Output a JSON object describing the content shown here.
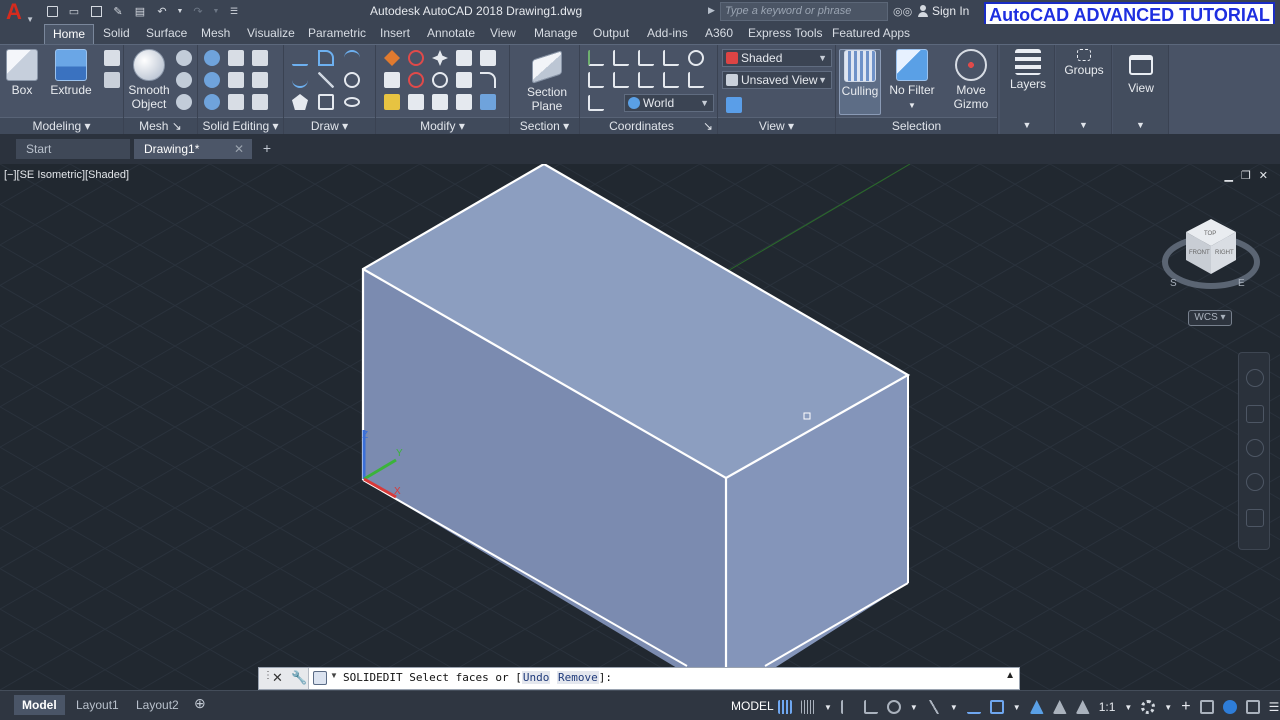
{
  "app": {
    "logo": "A",
    "window_title": "Autodesk AutoCAD 2018   Drawing1.dwg",
    "search_placeholder": "Type a keyword or phrase",
    "sign_in": "Sign In",
    "banner": "AutoCAD ADVANCED TUTORIAL"
  },
  "ribbon_tabs": [
    "Home",
    "Solid",
    "Surface",
    "Mesh",
    "Visualize",
    "Parametric",
    "Insert",
    "Annotate",
    "View",
    "Manage",
    "Output",
    "Add-ins",
    "A360",
    "Express Tools",
    "Featured Apps"
  ],
  "panels": {
    "modeling": {
      "title": "Modeling",
      "box": "Box",
      "extrude": "Extrude"
    },
    "mesh": {
      "title": "Mesh",
      "smooth_1": "Smooth",
      "smooth_2": "Object"
    },
    "solid_editing": {
      "title": "Solid Editing"
    },
    "draw": {
      "title": "Draw"
    },
    "modify": {
      "title": "Modify"
    },
    "section": {
      "title": "Section",
      "plane_1": "Section",
      "plane_2": "Plane"
    },
    "coordinates": {
      "title": "Coordinates",
      "ucs_value": "World"
    },
    "view": {
      "title": "View",
      "visual_style": "Shaded",
      "named_view": "Unsaved View"
    },
    "selection": {
      "title": "Selection",
      "culling": "Culling",
      "no_filter": "No Filter",
      "gizmo_1": "Move",
      "gizmo_2": "Gizmo"
    },
    "layers": {
      "label": "Layers"
    },
    "groups": {
      "label": "Groups"
    },
    "view_btn": {
      "label": "View"
    }
  },
  "doc_tabs": {
    "start": "Start",
    "drawing": "Drawing1*"
  },
  "viewport": {
    "label": "[−][SE Isometric][Shaded]",
    "wcs": "WCS",
    "viewcube_faces": [
      "TOP",
      "FRONT",
      "RIGHT"
    ],
    "compass": [
      "S",
      "E"
    ]
  },
  "command": {
    "name": "SOLIDEDIT",
    "prompt": "Select faces or",
    "options_open": "[",
    "opt_undo": "Undo",
    "opt_remove": "Remove",
    "options_close": "]:"
  },
  "status": {
    "layout_tabs": [
      "Model",
      "Layout1",
      "Layout2"
    ],
    "model": "MODEL",
    "scale": "1:1"
  },
  "colors": {
    "box_top": "#8a9cbf",
    "box_front": "#7c8db1",
    "box_right": "#8193b8",
    "edge": "#ffffff",
    "viewport_bg": "#212830",
    "accent": "#1e2fe0"
  }
}
